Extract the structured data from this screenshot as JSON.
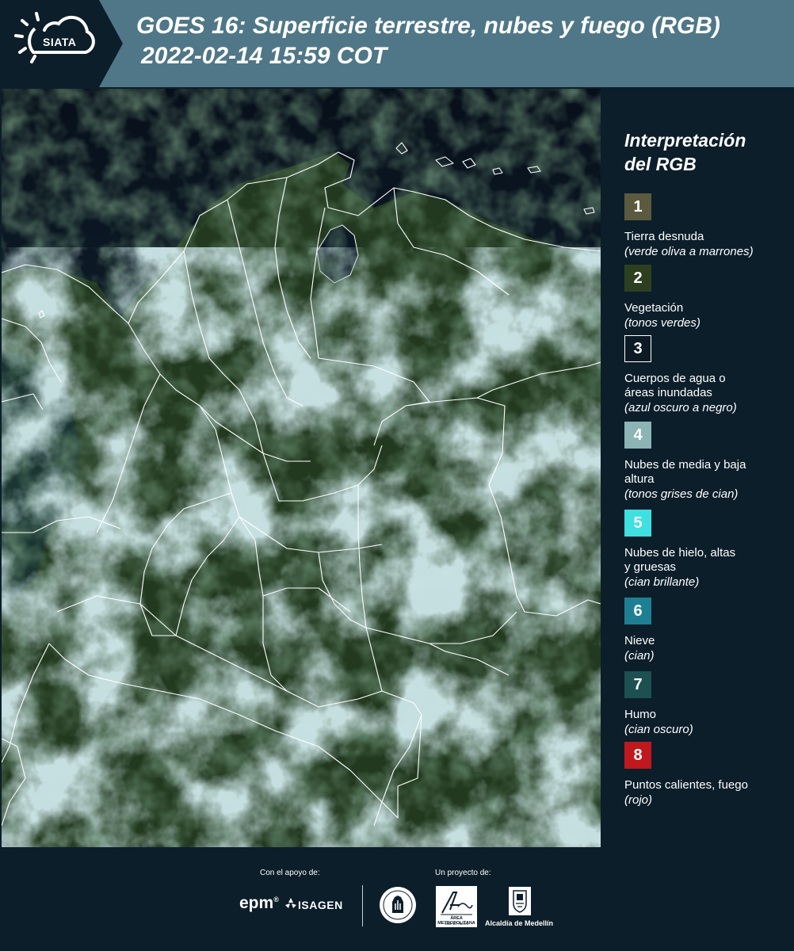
{
  "header": {
    "logo_text": "SIATA",
    "title_line1": "GOES 16: Superficie terrestre, nubes y fuego (RGB)",
    "title_line2": "2022-02-14 15:59 COT"
  },
  "legend": {
    "title_line1": "Interpretación",
    "title_line2": "del RGB",
    "items": [
      {
        "number": "1",
        "name": "Tierra desnuda",
        "desc": "(verde oliva a marrones)",
        "color": "#5a5a3e"
      },
      {
        "number": "2",
        "name": "Vegetación",
        "desc": "(tonos verdes)",
        "color": "#2c4020"
      },
      {
        "number": "3",
        "name": "Cuerpos de agua o áreas inundadas",
        "desc": "(azul oscuro a negro)",
        "color": "#0b1a24"
      },
      {
        "number": "4",
        "name": "Nubes de media y baja altura",
        "desc": "(tonos grises de cian)",
        "color": "#8cb4b4"
      },
      {
        "number": "5",
        "name": "Nubes de hielo, altas y gruesas",
        "desc": "(cian brillante)",
        "color": "#3ee0e0"
      },
      {
        "number": "6",
        "name": "Nieve",
        "desc": "(cian)",
        "color": "#1e7f93"
      },
      {
        "number": "7",
        "name": "Humo",
        "desc": "(cian oscuro)",
        "color": "#1d5050"
      },
      {
        "number": "8",
        "name": "Puntos calientes, fuego",
        "desc": "(rojo)",
        "color": "#c0181c"
      }
    ]
  },
  "footer": {
    "support_label": "Con el apoyo de:",
    "project_label": "Un proyecto de:",
    "sponsor_1": "epm",
    "sponsor_2": "ISAGEN",
    "partner_1": "ÁREA METROPOLITANA",
    "partner_1_sub": "Valle de Aburrá",
    "partner_2": "Alcaldía de Medellín"
  },
  "colors": {
    "background": "#0c1e2a",
    "header": "#4f7787",
    "boundary": "#ffffff"
  }
}
